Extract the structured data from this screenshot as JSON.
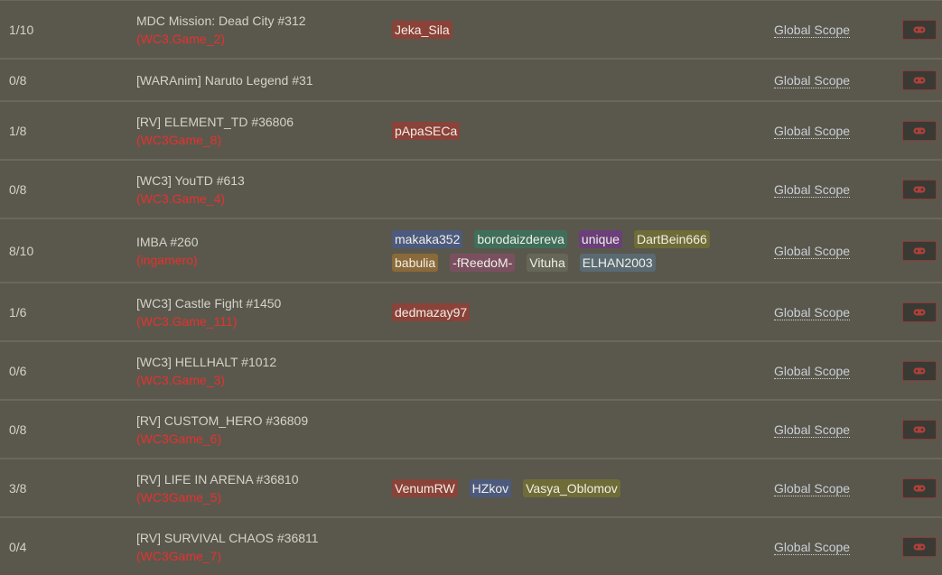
{
  "scope_label": "Global Scope",
  "tag_colors": {
    "red": "#8a4239",
    "blue": "#4c5a7e",
    "green": "#3f6f5a",
    "purple": "#6a3f7a",
    "olive": "#6f6c38",
    "orange": "#8a6a3a",
    "pink": "#7a5060",
    "grey": "#666658",
    "slate": "#5a6a72"
  },
  "rows": [
    {
      "count": "1/10",
      "title": "MDC Mission: Dead City #312",
      "host": "(WC3.Game_2)",
      "players": [
        {
          "name": "Jeka_Sila",
          "color": "red"
        }
      ]
    },
    {
      "count": "0/8",
      "title": "[WARAnim] Naruto Legend #31",
      "host": "",
      "players": []
    },
    {
      "count": "1/8",
      "title": "[RV] ELEMENT_TD #36806",
      "host": "(WC3Game_8)",
      "players": [
        {
          "name": "pApaSECa",
          "color": "red"
        }
      ]
    },
    {
      "count": "0/8",
      "title": "[WC3] YouTD #613",
      "host": "(WC3.Game_4)",
      "players": []
    },
    {
      "count": "8/10",
      "title": "IMBA #260",
      "host": "(ingamero)",
      "players": [
        {
          "name": "makaka352",
          "color": "blue"
        },
        {
          "name": "borodaizdereva",
          "color": "green"
        },
        {
          "name": "unique",
          "color": "purple"
        },
        {
          "name": "DartBein666",
          "color": "olive"
        },
        {
          "name": "babulia",
          "color": "orange"
        },
        {
          "name": "-fReedoM-",
          "color": "pink"
        },
        {
          "name": "Vituha",
          "color": "grey"
        },
        {
          "name": "ELHAN2003",
          "color": "slate"
        }
      ]
    },
    {
      "count": "1/6",
      "title": "[WC3] Castle Fight #1450",
      "host": "(WC3.Game_111)",
      "players": [
        {
          "name": "dedmazay97",
          "color": "red"
        }
      ]
    },
    {
      "count": "0/6",
      "title": "[WC3] HELLHALT #1012",
      "host": "(WC3.Game_3)",
      "players": []
    },
    {
      "count": "0/8",
      "title": "[RV] CUSTOM_HERO #36809",
      "host": "(WC3Game_6)",
      "players": []
    },
    {
      "count": "3/8",
      "title": "[RV] LIFE IN ARENA #36810",
      "host": "(WC3Game_5)",
      "players": [
        {
          "name": "VenumRW",
          "color": "red"
        },
        {
          "name": "HZkov",
          "color": "blue"
        },
        {
          "name": "Vasya_Oblomov",
          "color": "olive"
        }
      ]
    },
    {
      "count": "0/4",
      "title": "[RV] SURVIVAL CHAOS #36811",
      "host": "(WC3Game_7)",
      "players": []
    }
  ]
}
